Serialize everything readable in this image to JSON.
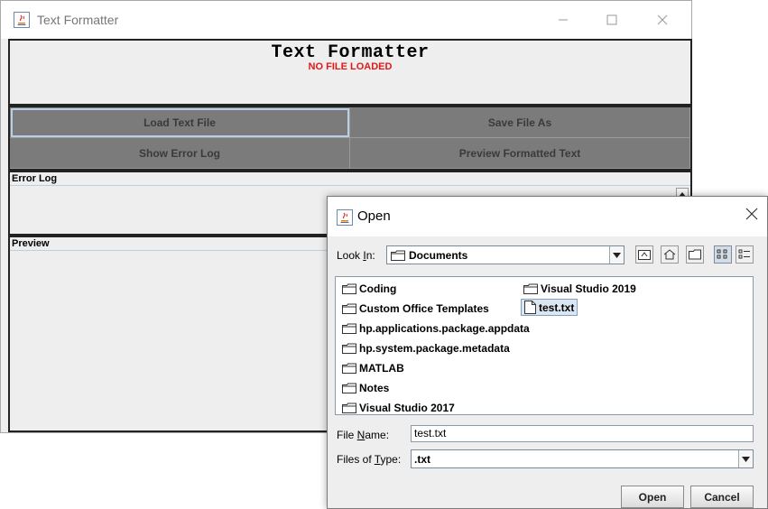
{
  "main_window": {
    "title": "Text Formatter",
    "heading": "Text Formatter",
    "status": "NO FILE LOADED",
    "buttons": {
      "load": "Load Text File",
      "save_as": "Save File As",
      "show_error_log": "Show  Error Log",
      "preview_formatted": "Preview Formatted Text"
    },
    "error_log_title": "Error Log",
    "preview_title": "Preview"
  },
  "open_dialog": {
    "title": "Open",
    "look_in_label": "Look In:",
    "look_in_mnemonic": "I",
    "look_in_value": "Documents",
    "files": [
      {
        "name": "Coding",
        "type": "folder"
      },
      {
        "name": "Custom Office Templates",
        "type": "folder"
      },
      {
        "name": "hp.applications.package.appdata",
        "type": "folder"
      },
      {
        "name": "hp.system.package.metadata",
        "type": "folder"
      },
      {
        "name": "MATLAB",
        "type": "folder"
      },
      {
        "name": "Notes",
        "type": "folder"
      },
      {
        "name": "Visual Studio 2017",
        "type": "folder"
      },
      {
        "name": "Visual Studio 2019",
        "type": "folder"
      },
      {
        "name": "test.txt",
        "type": "file",
        "selected": true
      }
    ],
    "file_name_label": "File Name:",
    "file_name_value": "test.txt",
    "files_of_type_label": "Files of Type:",
    "files_of_type_value": ".txt",
    "open_button": "Open",
    "cancel_button": "Cancel"
  },
  "colors": {
    "status_red": "#e01818",
    "button_gray": "#7b7b7b",
    "selection_blue": "#dce6f1"
  }
}
